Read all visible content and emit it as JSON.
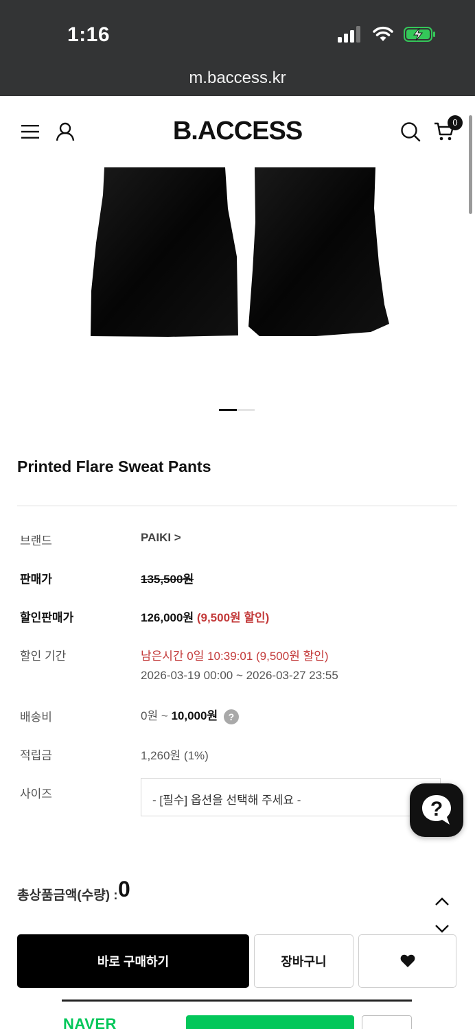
{
  "status_bar": {
    "time": "1:16",
    "url": "m.baccess.kr"
  },
  "header": {
    "logo": "B.ACCESS",
    "cart_count": "0"
  },
  "product": {
    "title": "Printed Flare Sweat Pants",
    "image_slide_total": 2,
    "image_slide_active": 1
  },
  "info": {
    "brand_label": "브랜드",
    "brand_value": "PAIKI >",
    "price_label": "판매가",
    "price_value": "135,500원",
    "sale_price_label": "할인판매가",
    "sale_price_value": "126,000원",
    "sale_discount": "(9,500원 할인)",
    "period_label": "할인 기간",
    "period_remaining": "남은시간 0일 10:39:01 (9,500원 할인)",
    "period_range": "2026-03-19 00:00 ~ 2026-03-27 23:55",
    "shipping_label": "배송비",
    "shipping_min": "0원 ~ ",
    "shipping_max": "10,000원",
    "shipping_help": "?",
    "points_label": "적립금",
    "points_value": "1,260원 (1%)",
    "size_label": "사이즈",
    "size_placeholder": "- [필수] 옵션을 선택해 주세요 -"
  },
  "total": {
    "label": "총상품금액(수량) : ",
    "value": "0"
  },
  "actions": {
    "buy_now": "바로 구매하기",
    "add_to_cart": "장바구니"
  },
  "naver": {
    "logo": "NAVER"
  },
  "colors": {
    "brand": "#111111",
    "discount": "#c33a3a",
    "naver_green": "#03c75a",
    "status_bar": "#333435"
  },
  "icons": [
    "signal-icon",
    "wifi-icon",
    "battery-charging-icon",
    "menu-icon",
    "user-icon",
    "search-icon",
    "cart-icon",
    "chat-help-icon",
    "chevron-up-icon",
    "chevron-down-icon",
    "heart-icon"
  ]
}
